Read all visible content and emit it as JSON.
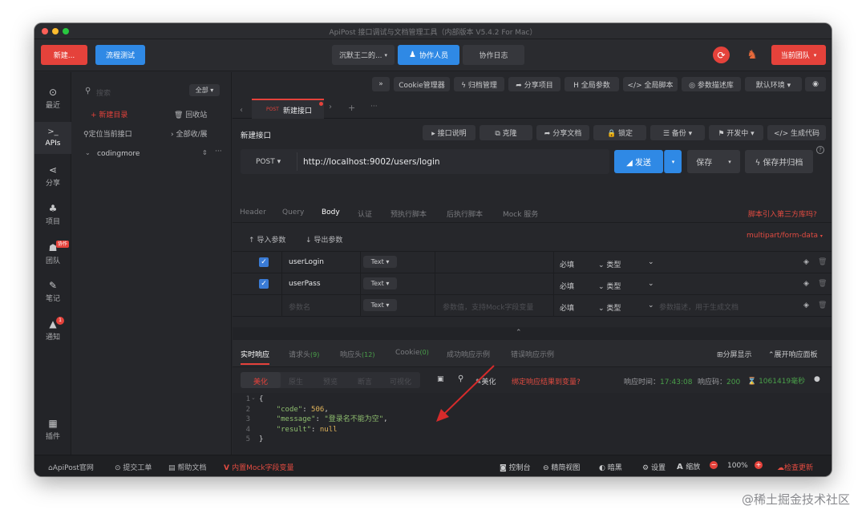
{
  "window": {
    "title": "ApiPost 接口调试与文档管理工具（内部版本 V5.4.2 For Mac）"
  },
  "toolbar": {
    "new_label": "新建...",
    "flow_test_label": "流程测试",
    "user_label": "沉默王二的...",
    "user_caret": "▾",
    "collaborators_label": "协作人员",
    "collab_log_label": "协作日志",
    "team_label": "当前团队",
    "team_caret": "▾"
  },
  "sidebar": {
    "items": [
      {
        "icon": "⊙",
        "label": "最近"
      },
      {
        "icon": ">_",
        "label": "APIs"
      },
      {
        "icon": "⋖",
        "label": "分享"
      },
      {
        "icon": "♣",
        "label": "项目"
      },
      {
        "icon": "☗",
        "label": "团队",
        "badge": "协作"
      },
      {
        "icon": "✎",
        "label": "笔记"
      },
      {
        "icon": "▲",
        "label": "通知",
        "badge": "1"
      },
      {
        "icon": "▦",
        "label": "插件"
      }
    ]
  },
  "tree": {
    "search_placeholder": "搜索",
    "filter_label": "全部 ▾",
    "new_dir_label": "新建目录",
    "trash_label": "回收站",
    "locate_label": "定位当前接口",
    "expand_label": "全部收/展",
    "project_name": "codingmore"
  },
  "top_actions": {
    "collapse": "»",
    "cookie": "Cookie管理器",
    "archive": "ϟ 归档管理",
    "share_project": "➦ 分享项目",
    "global_params": "H 全局参数",
    "global_script": "</> 全局脚本",
    "param_desc": "◎ 参数描述库",
    "env": "默认环境  ▾",
    "eye": "◉"
  },
  "tabs": {
    "method": "POST",
    "name": "新建接口",
    "add": "+",
    "more": "···"
  },
  "request": {
    "title": "新建接口",
    "doc_btn": "▸ 接口说明",
    "clone_btn": "⧉ 克隆",
    "share_doc_btn": "➦ 分享文档",
    "lock_btn": "🔒 锁定",
    "backup_btn": "☰ 备份  ▾",
    "dev_btn": "⚑ 开发中  ▾",
    "gen_code_btn": "</> 生成代码",
    "method": "POST ▾",
    "url": "http://localhost:9002/users/login",
    "send_btn": "◢ 发送",
    "save_btn": "保存",
    "save_archive_btn": "ϟ 保存并归档",
    "help": "?"
  },
  "req_tabs": [
    "Header",
    "Query",
    "Body",
    "认证",
    "预执行脚本",
    "后执行脚本",
    "Mock 服务"
  ],
  "third_party_link": "脚本引入第三方库吗?",
  "body": {
    "import_btn": "导入参数",
    "export_btn": "导出参数",
    "content_type": "multipart/form-data",
    "rows": [
      {
        "checked": true,
        "key": "userLogin",
        "type": "Text",
        "value": "",
        "required": "必填",
        "kind": "类型"
      },
      {
        "checked": true,
        "key": "userPass",
        "type": "Text",
        "value": "",
        "required": "必填",
        "kind": "类型"
      }
    ],
    "empty_row": {
      "key_placeholder": "参数名",
      "type": "Text",
      "value_placeholder": "参数值，支持Mock字段变量",
      "required": "必填",
      "kind": "类型",
      "desc_placeholder": "参数描述，用于生成文档"
    }
  },
  "response": {
    "tabs": [
      {
        "label": "实时响应",
        "count": ""
      },
      {
        "label": "请求头",
        "count": "(9)"
      },
      {
        "label": "响应头",
        "count": "(12)"
      },
      {
        "label": "Cookie",
        "count": "(0)"
      },
      {
        "label": "成功响应示例",
        "count": ""
      },
      {
        "label": "错误响应示例",
        "count": ""
      }
    ],
    "split_btn": "分屏显示",
    "expand_btn": "展开响应面板",
    "view_tabs": [
      "美化",
      "原生",
      "预览",
      "断言",
      "可视化"
    ],
    "beautify_btn": "美化",
    "bind_link": "绑定响应结果到变量?",
    "time_label": "响应时间：",
    "time_value": "17:43:08",
    "code_label": "响应码：",
    "code_value": "200",
    "duration_value": "1061419毫秒",
    "code_lines": [
      {
        "num": "1",
        "text": "{"
      },
      {
        "num": "2",
        "key": "\"code\"",
        "sep": ": ",
        "val": "506",
        "end": ","
      },
      {
        "num": "3",
        "key": "\"message\"",
        "sep": ": ",
        "val": "\"登录名不能为空\"",
        "end": ","
      },
      {
        "num": "4",
        "key": "\"result\"",
        "sep": ": ",
        "val": "null",
        "end": ""
      },
      {
        "num": "5",
        "text": "}"
      }
    ]
  },
  "statusbar": {
    "official": "ApiPost官网",
    "ticket": "提交工单",
    "help_doc": "帮助文档",
    "mock_vars": "内置Mock字段变量",
    "console": "控制台",
    "compact": "精简视图",
    "dark": "暗黑",
    "settings": "设置",
    "zoom_label": "缩放",
    "zoom_value": "100%",
    "update": "检查更新"
  },
  "watermark": "@稀土掘金技术社区",
  "colors": {
    "accent_red": "#e5423b",
    "accent_blue": "#2f89e5",
    "link_red": "#e24b41",
    "json_key": "#8fbf6f",
    "json_number": "#e0b35a",
    "arrow": "#d62b2b"
  }
}
